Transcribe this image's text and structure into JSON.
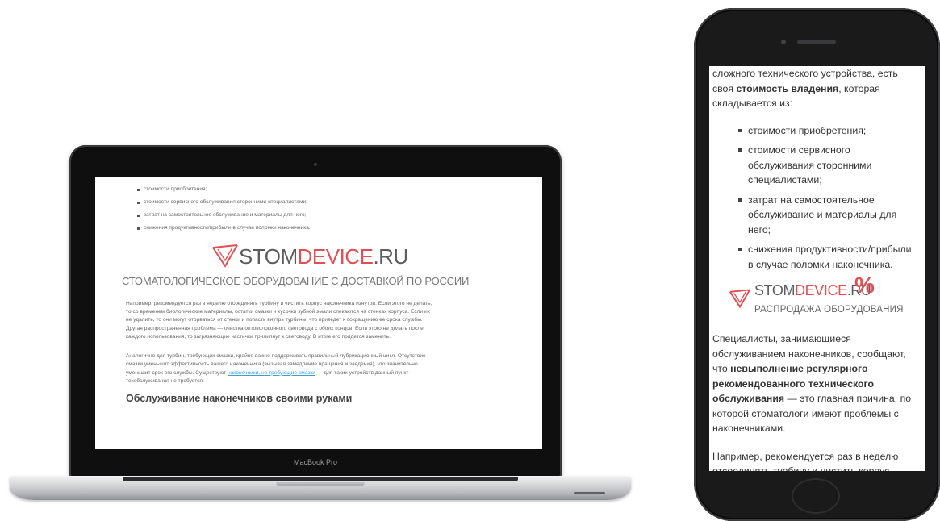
{
  "laptop": {
    "brand": "MacBook Pro",
    "bullets": [
      "стоимости приобретения;",
      "стоимости сервисного обслуживания сторонними специалистами;",
      "затрат на самостоятельное обслуживание и материалы для него;",
      "снижения продуктивности/прибыли в случае поломки наконечника."
    ],
    "logo": {
      "part1": "STOM",
      "part2": "DEVICE",
      "part3": ".RU"
    },
    "tagline": "СТОМАТОЛОГИЧЕСКОЕ ОБОРУДОВАНИЕ С ДОСТАВКОЙ ПО РОССИИ",
    "para1": "Например, рекомендуется раз в неделю отсоединять турбину и чистить корпус наконечника изнутри. Если этого не делать, то со временем биологические материалы, остатки смазки и кусочки зубной эмали спекаются на стенках корпуса. Если их не удалить, то они могут оторваться от стенки и попасть внутрь турбины, что приведет к сокращению ее срока службы. Другая распространенная проблема — очистка оптоволоконного световода с обоих концов. Если этого не делать после каждого использования, то загрязняющие частички прилипнут к световоду. В итоге его придется заменить.",
    "para2_start": "Аналогично для турбин, требующих смазки, крайне важно поддерживать правильный лубрикационный цикл. Отсутствие смазки уменьшит эффективность вашего наконечника (вызывая замедление вращения и заедения), что значительно уменьшит срок его службы. Существуют ",
    "para2_link": "наконечники, не требующие смазки",
    "para2_end": " — для таких устройств данный пункт техобслуживания не требуется.",
    "heading": "Обслуживание наконечников своими руками"
  },
  "phone": {
    "intro_a": "сложного технического устройства, есть своя ",
    "intro_bold": "стоимость владения",
    "intro_b": ", которая складывается из:",
    "bullets": [
      "стоимости приобретения;",
      "стоимости сервисного обслуживания сторонними специалистами;",
      "затрат на самостоятельное обслуживание и материалы для него;",
      "снижения продуктивности/прибыли в случае поломки наконечника."
    ],
    "banner": {
      "part1": "STOM",
      "part2": "DEVICE",
      "part3": ".RU",
      "percent": "%",
      "subtitle": "РАСПРОДАЖА ОБОРУДОВАНИЯ"
    },
    "para1_a": "Специалисты, занимающиеся обслуживанием наконечников, сообщают, что ",
    "para1_bold": "невыполнение регулярного рекомендованного технического обслуживания",
    "para1_b": " — это главная причина, по которой стоматологи имеют проблемы с наконечниками.",
    "para2": "Например, рекомендуется раз в неделю отсоединять турбину и чистить корпус наконечника изнутри. Если этого не делать, то со временем биологические материалы, остатки смазки и кусочки зубной эмали"
  },
  "colors": {
    "brand_red": "#e24f52",
    "brand_gray": "#5c5c5c",
    "link": "#3b9fd7"
  }
}
